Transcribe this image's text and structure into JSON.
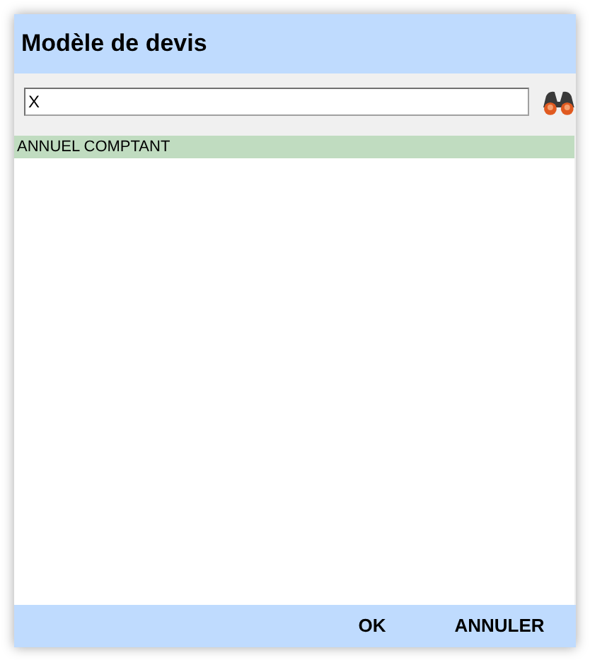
{
  "window": {
    "title": "Modèle de devis"
  },
  "search": {
    "value": "X"
  },
  "items": [
    {
      "label": "ANNUEL COMPTANT",
      "selected": true
    }
  ],
  "buttons": [
    "OK",
    "ANNULER"
  ]
}
